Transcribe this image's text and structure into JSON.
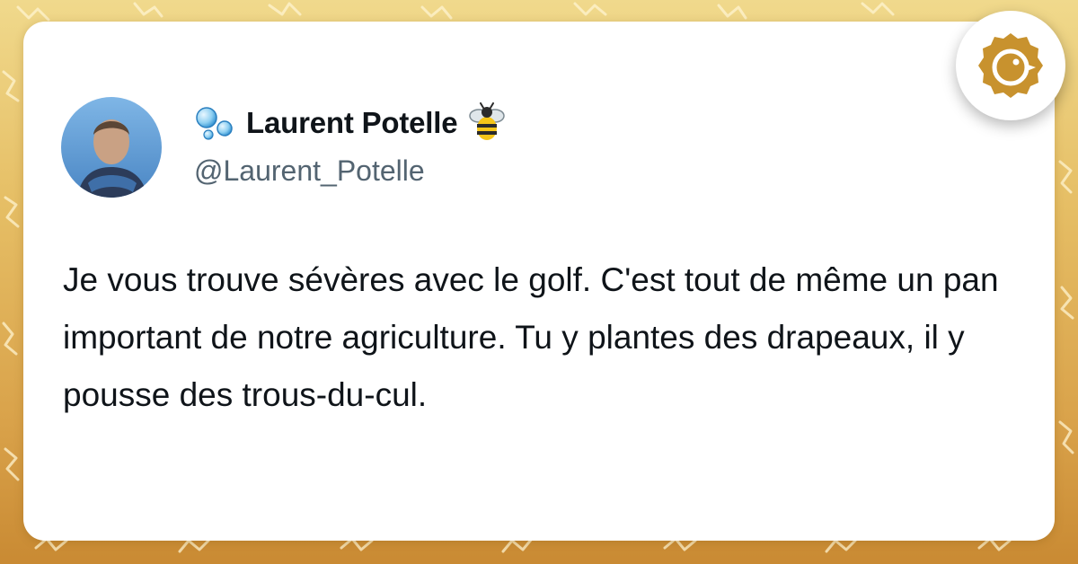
{
  "tweet": {
    "author": {
      "display_name": "Laurent Potelle",
      "handle": "@Laurent_Potelle",
      "name_prefix_icon": "bubbles-icon",
      "name_suffix_icon": "bee-icon",
      "avatar": "profile-photo"
    },
    "text": "Je vous trouve sévères avec le golf. C'est tout de même un pan important de notre agriculture. Tu y plantes des drapeaux, il y pousse des trous-du-cul."
  },
  "brand": {
    "icon": "golden-bird-logo-icon"
  },
  "colors": {
    "background_top": "#f0d98c",
    "background_bottom": "#c98a33",
    "card": "#ffffff",
    "text_primary": "#0f1419",
    "text_secondary": "#536471",
    "brand_gold": "#c8922e"
  }
}
